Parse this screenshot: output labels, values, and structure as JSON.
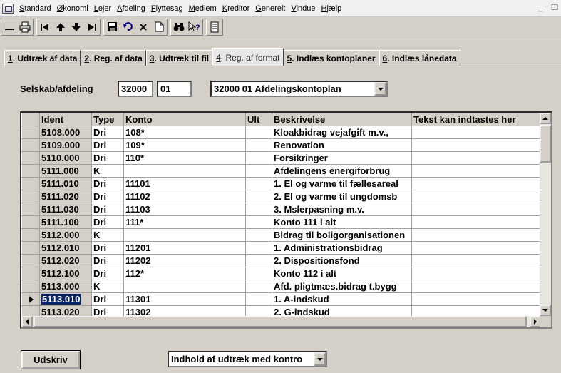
{
  "menu": {
    "items": [
      {
        "u": "S",
        "rest": "tandard"
      },
      {
        "u": "Ø",
        "rest": "konomi"
      },
      {
        "u": "L",
        "rest": "ejer"
      },
      {
        "u": "A",
        "rest": "fdeling"
      },
      {
        "u": "F",
        "rest": "lyttesag"
      },
      {
        "u": "M",
        "rest": "edlem"
      },
      {
        "u": "K",
        "rest": "reditor"
      },
      {
        "u": "G",
        "rest": "enerelt"
      },
      {
        "u": "V",
        "rest": "indue"
      },
      {
        "u": "H",
        "rest": "jælp"
      }
    ],
    "minimize": "_",
    "restore": "❐"
  },
  "toolbar": {
    "icons": [
      "minimize-icon",
      "printer-icon",
      "first-record-icon",
      "previous-record-icon",
      "next-record-icon",
      "last-record-icon",
      "save-icon",
      "undo-icon",
      "delete-icon",
      "new-document-icon",
      "binoculars-icon",
      "help-pointer-icon",
      "notes-icon"
    ]
  },
  "tabs": [
    {
      "num": "1",
      "label": ". Udtræk af data",
      "active": false
    },
    {
      "num": "2",
      "label": ". Reg. af data",
      "active": false
    },
    {
      "num": "3",
      "label": ". Udtræk til fil",
      "active": false
    },
    {
      "num": "4",
      "label": ". Reg. af format",
      "active": true
    },
    {
      "num": "5",
      "label": ". Indlæs kontoplaner",
      "active": false
    },
    {
      "num": "6",
      "label": ". Indlæs lånedata",
      "active": false
    }
  ],
  "company": {
    "label": "Selskab/afdeling",
    "company_no": "32000",
    "dept_no": "01",
    "selected": "32000 01 Afdelingskontoplan"
  },
  "grid": {
    "columns": [
      "Ident",
      "Type",
      "Konto",
      "Ult",
      "Beskrivelse",
      "Tekst kan indtastes her"
    ],
    "rows": [
      {
        "ident": "5108.000",
        "type": "Dri",
        "konto": "108*",
        "ult": "",
        "desc": "Kloakbidrag vejafgift m.v.,",
        "text": ""
      },
      {
        "ident": "5109.000",
        "type": "Dri",
        "konto": "109*",
        "ult": "",
        "desc": "Renovation",
        "text": ""
      },
      {
        "ident": "5110.000",
        "type": "Dri",
        "konto": "110*",
        "ult": "",
        "desc": "Forsikringer",
        "text": ""
      },
      {
        "ident": "5111.000",
        "type": "K",
        "konto": "",
        "ult": "",
        "desc": "Afdelingens energiforbrug",
        "text": ""
      },
      {
        "ident": "5111.010",
        "type": "Dri",
        "konto": "11101",
        "ult": "",
        "desc": "1. El og varme til fællesareal",
        "text": ""
      },
      {
        "ident": "5111.020",
        "type": "Dri",
        "konto": "11102",
        "ult": "",
        "desc": "2. El og varme til ungdomsb",
        "text": ""
      },
      {
        "ident": "5111.030",
        "type": "Dri",
        "konto": "11103",
        "ult": "",
        "desc": "3. Mslerpasning m.v.",
        "text": ""
      },
      {
        "ident": "5111.100",
        "type": "Dri",
        "konto": "111*",
        "ult": "",
        "desc": "Konto 111 i alt",
        "text": ""
      },
      {
        "ident": "5112.000",
        "type": "K",
        "konto": "",
        "ult": "",
        "desc": "Bidrag til boligorganisationen",
        "text": ""
      },
      {
        "ident": "5112.010",
        "type": "Dri",
        "konto": "11201",
        "ult": "",
        "desc": "1. Administrationsbidrag",
        "text": ""
      },
      {
        "ident": "5112.020",
        "type": "Dri",
        "konto": "11202",
        "ult": "",
        "desc": "2. Dispositionsfond",
        "text": ""
      },
      {
        "ident": "5112.100",
        "type": "Dri",
        "konto": "112*",
        "ult": "",
        "desc": "Konto 112 i alt",
        "text": ""
      },
      {
        "ident": "5113.000",
        "type": "K",
        "konto": "",
        "ult": "",
        "desc": "Afd. pligtmæs.bidrag t.bygg",
        "text": ""
      },
      {
        "ident": "5113.010",
        "type": "Dri",
        "konto": "11301",
        "ult": "",
        "desc": "1. A-indskud",
        "text": "",
        "current": true
      },
      {
        "ident": "5113.020",
        "type": "Dri",
        "konto": "11302",
        "ult": "",
        "desc": "2. G-indskud",
        "text": ""
      }
    ]
  },
  "bottom": {
    "print_label": "Udskriv",
    "report_select": "Indhold af udtræk med kontro"
  }
}
